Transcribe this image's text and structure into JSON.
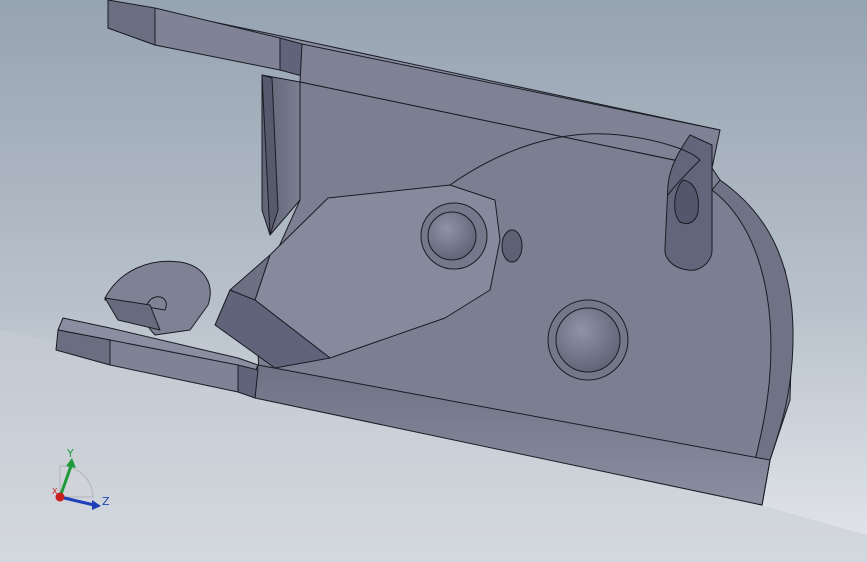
{
  "viewport": {
    "background_top": "#9aa6b4",
    "background_bottom": "#dfe3e8",
    "part_color": "#7c8092"
  },
  "triad": {
    "y_label": "Y",
    "z_label": "Z",
    "x_label": "X",
    "y_color": "#1f9a3a",
    "z_color": "#1d3fb8",
    "x_color": "#c81e1e"
  }
}
